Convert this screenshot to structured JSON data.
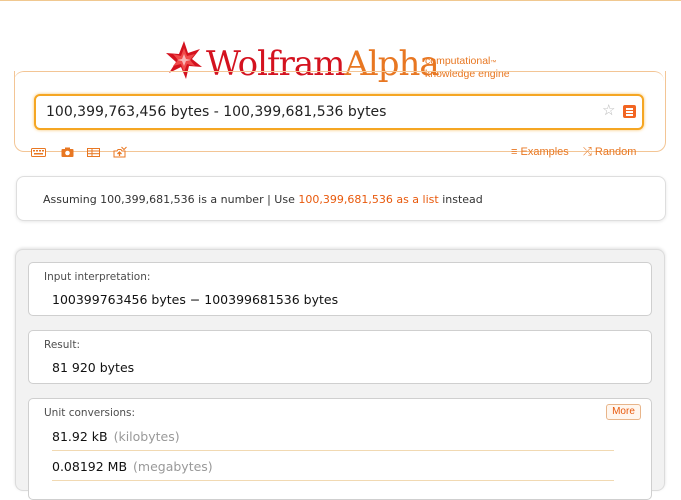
{
  "logo": {
    "wolfram": "Wolfram",
    "alpha": "Alpha",
    "tagline_1": "computational",
    "tagline_tm": "™",
    "tagline_2": "knowledge engine"
  },
  "search": {
    "value": "100,399,763,456 bytes - 100,399,681,536 bytes"
  },
  "links": {
    "examples": "Examples",
    "random": "Random"
  },
  "assumption": {
    "prefix": "Assuming 100,399,681,536 is a number",
    "separator": " | Use ",
    "link": "100,399,681,536 as a list",
    "suffix": " instead"
  },
  "pods": {
    "input": {
      "title": "Input interpretation:",
      "value": "100399763456 bytes − 100399681536 bytes"
    },
    "result": {
      "title": "Result:",
      "value": "81 920 bytes"
    },
    "conversions": {
      "title": "Unit conversions:",
      "more": "More",
      "rows": [
        {
          "value": "81.92 kB",
          "unit": "(kilobytes)"
        },
        {
          "value": "0.08192 MB",
          "unit": "(megabytes)"
        }
      ]
    }
  },
  "colors": {
    "accent": "#e87722",
    "logo_red": "#d4121f",
    "search_border": "#f5a623",
    "link": "#e8590c"
  },
  "icons": [
    "spikey-logo-icon",
    "star-icon",
    "go-button-icon",
    "keyboard-icon",
    "camera-icon",
    "table-icon",
    "upload-icon",
    "examples-icon",
    "random-icon"
  ]
}
